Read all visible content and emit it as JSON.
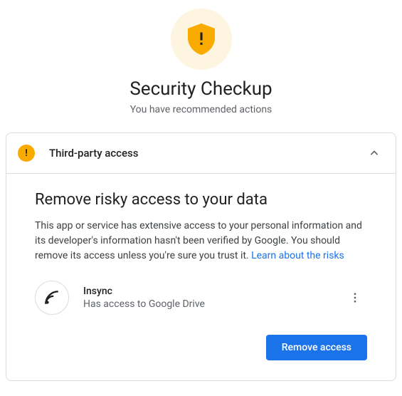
{
  "header": {
    "title": "Security Checkup",
    "subtitle": "You have recommended actions"
  },
  "card": {
    "header_title": "Third-party access",
    "section_title": "Remove risky access to your data",
    "description": "This app or service has extensive access to your personal information and its developer's information hasn't been verified by Google. You should remove its access unless you're sure you trust it. ",
    "learn_link": "Learn about the risks",
    "app": {
      "name": "Insync",
      "access": "Has access to Google Drive"
    },
    "remove_label": "Remove access"
  }
}
